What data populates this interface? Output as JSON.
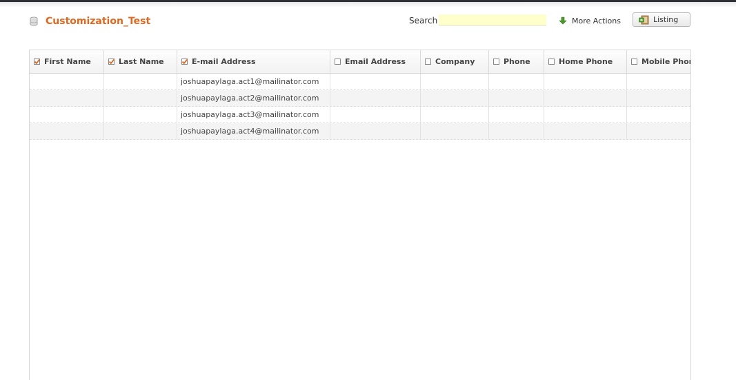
{
  "list": {
    "title": "Customization_Test",
    "icon": "database-icon"
  },
  "search": {
    "label": "Search",
    "value": "",
    "placeholder": ""
  },
  "toolbar": {
    "more_actions_label": "More Actions",
    "more_actions_icon": "green-down-arrow-icon",
    "listing_label": "Listing",
    "listing_icon": "listing-view-icon"
  },
  "colors": {
    "accent": "#e2661e",
    "search_bg": "#ffffcc",
    "arrow": "#4a9a2a"
  },
  "table": {
    "columns": [
      {
        "label": "First Name",
        "checked": true
      },
      {
        "label": "Last Name",
        "checked": true
      },
      {
        "label": "E-mail Address",
        "checked": true
      },
      {
        "label": "Email Address",
        "checked": false
      },
      {
        "label": "Company",
        "checked": false
      },
      {
        "label": "Phone",
        "checked": false
      },
      {
        "label": "Home Phone",
        "checked": false
      },
      {
        "label": "Mobile Phone",
        "checked": false
      }
    ],
    "rows": [
      [
        "",
        "",
        "joshuapaylaga.act1@mailinator.com",
        "",
        "",
        "",
        "",
        ""
      ],
      [
        "",
        "",
        "joshuapaylaga.act2@mailinator.com",
        "",
        "",
        "",
        "",
        ""
      ],
      [
        "",
        "",
        "joshuapaylaga.act3@mailinator.com",
        "",
        "",
        "",
        "",
        ""
      ],
      [
        "",
        "",
        "joshuapaylaga.act4@mailinator.com",
        "",
        "",
        "",
        "",
        ""
      ]
    ]
  }
}
